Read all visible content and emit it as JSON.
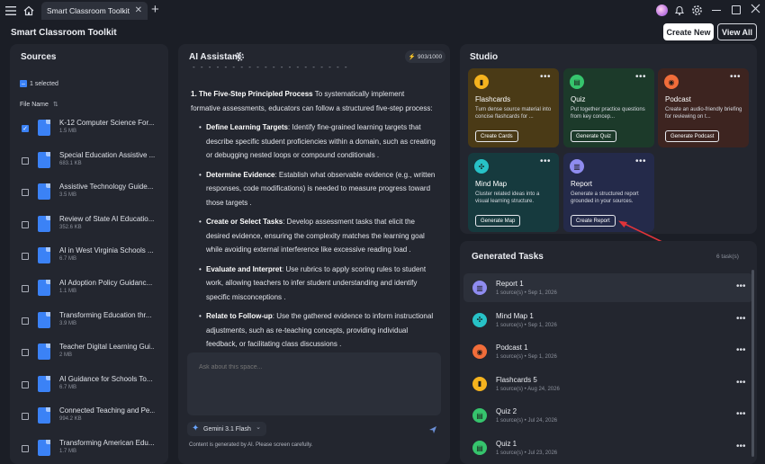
{
  "window": {
    "tab_title": "Smart Classroom Toolkit",
    "tab_close": "✕",
    "new_tab": "+"
  },
  "header": {
    "app_title": "Smart Classroom Toolkit",
    "create_new": "Create New",
    "view_all": "View All"
  },
  "sources": {
    "title": "Sources",
    "selected": "1 selected",
    "file_name_header": "File Name",
    "items": [
      {
        "name": "K-12 Computer Science For...",
        "size": "1.5 MB",
        "checked": true
      },
      {
        "name": "Special Education Assistive ...",
        "size": "683.1 KB",
        "checked": false
      },
      {
        "name": "Assistive Technology Guide...",
        "size": "3.5 MB",
        "checked": false
      },
      {
        "name": "Review of State AI Educatio...",
        "size": "352.6 KB",
        "checked": false
      },
      {
        "name": "AI in West Virginia Schools ...",
        "size": "6.7 MB",
        "checked": false
      },
      {
        "name": "AI Adoption Policy Guidanc...",
        "size": "1.1 MB",
        "checked": false
      },
      {
        "name": "Transforming Education thr...",
        "size": "3.9 MB",
        "checked": false
      },
      {
        "name": "Teacher Digital Learning Gui...",
        "size": "2 MB",
        "checked": false
      },
      {
        "name": "AI Guidance for Schools To...",
        "size": "6.7 MB",
        "checked": false
      },
      {
        "name": "Connected Teaching and Pe...",
        "size": "994.2 KB",
        "checked": false
      },
      {
        "name": "Transforming American Edu...",
        "size": "1.7 MB",
        "checked": false
      }
    ]
  },
  "assistant": {
    "title": "AI Assistant",
    "counter": "903/1000",
    "heading_num": "1. The Five-Step Principled Process",
    "heading_text": " To systematically implement formative assessments, educators can follow a structured five-step process:",
    "bullets": [
      {
        "term": "Define Learning Targets",
        "text": ": Identify fine-grained learning targets that describe specific student proficiencies within a domain, such as creating or debugging nested loops or compound conditionals ."
      },
      {
        "term": "Determine Evidence",
        "text": ": Establish what observable evidence (e.g., written responses, code modifications) is needed to measure progress toward those targets ."
      },
      {
        "term": "Create or Select Tasks",
        "text": ": Develop assessment tasks that elicit the desired evidence, ensuring the complexity matches the learning goal while avoiding external interference like excessive reading load ."
      },
      {
        "term": "Evaluate and Interpret",
        "text": ": Use rubrics to apply scoring rules to student work, allowing teachers to infer student understanding and identify specific misconceptions ."
      },
      {
        "term": "Relate to Follow-up",
        "text": ": Use the gathered evidence to inform instructional adjustments, such as re-teaching concepts, providing individual feedback, or facilitating class discussions ."
      }
    ],
    "placeholder": "Ask about this space...",
    "model": "Gemini 3.1 Flash",
    "disclaimer": "Content is generated by AI. Please screen carefully."
  },
  "studio": {
    "title": "Studio",
    "cards": [
      {
        "title": "Flashcards",
        "desc": "Turn dense source material into concise flashcards for ...",
        "button": "Create Cards",
        "icon": "flashcards-icon",
        "bg": "#4a3a16",
        "icon_color": "#f5b31e"
      },
      {
        "title": "Quiz",
        "desc": "Put together practice questions from key concep...",
        "button": "Generate Quiz",
        "icon": "quiz-icon",
        "bg": "#1c3a2a",
        "icon_color": "#36c46d"
      },
      {
        "title": "Podcast",
        "desc": "Create an audio-friendly briefing for reviewing on t...",
        "button": "Generate Podcast",
        "icon": "podcast-icon",
        "bg": "#3d2420",
        "icon_color": "#f16d3a"
      },
      {
        "title": "Mind Map",
        "desc": "Cluster related ideas into a visual learning structure.",
        "button": "Generate Map",
        "icon": "mind-map-icon",
        "bg": "#163a3e",
        "icon_color": "#27c2c7"
      },
      {
        "title": "Report",
        "desc": "Generate a structured report grounded in your sources.",
        "button": "Create Report",
        "icon": "report-icon",
        "bg": "#242a4a",
        "icon_color": "#8f8cf0"
      }
    ]
  },
  "tasks": {
    "title": "Generated Tasks",
    "count": "6 task(s)",
    "items": [
      {
        "name": "Report 1",
        "meta": "1 source(s) • Sep 1, 2026",
        "icon_color": "#8f8cf0",
        "icon": "report-icon"
      },
      {
        "name": "Mind Map 1",
        "meta": "1 source(s) • Sep 1, 2026",
        "icon_color": "#27c2c7",
        "icon": "mind-map-icon"
      },
      {
        "name": "Podcast 1",
        "meta": "1 source(s) • Sep 1, 2026",
        "icon_color": "#f16d3a",
        "icon": "podcast-icon"
      },
      {
        "name": "Flashcards 5",
        "meta": "1 source(s) • Aug 24, 2026",
        "icon_color": "#f5b31e",
        "icon": "flashcards-icon"
      },
      {
        "name": "Quiz 2",
        "meta": "1 source(s) • Jul 24, 2026",
        "icon_color": "#36c46d",
        "icon": "quiz-icon"
      },
      {
        "name": "Quiz 1",
        "meta": "1 source(s) • Jul 23, 2026",
        "icon_color": "#36c46d",
        "icon": "quiz-icon"
      }
    ]
  },
  "colors": {
    "accent": "#3b82f6",
    "annotation_arrow": "#e0343a"
  }
}
